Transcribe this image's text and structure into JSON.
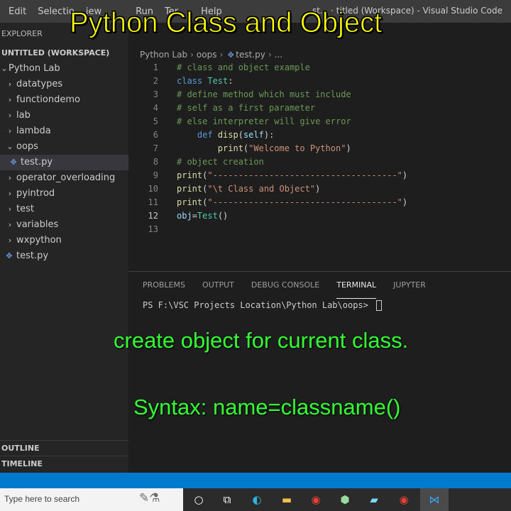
{
  "window": {
    "menus": [
      "Edit",
      "Selectio",
      "iew",
      "Run",
      "Ter",
      "Help"
    ],
    "title": "st... · titled (Workspace) - Visual Studio Code"
  },
  "overlays": {
    "title": "Python Class and Object",
    "line1": "create object for current class.",
    "line2": "Syntax: name=classname()"
  },
  "sidebar": {
    "explorer_label": "EXPLORER",
    "workspace_label": "UNTITLED (WORKSPACE)",
    "root_folder": "Python Lab",
    "items": [
      {
        "label": "datatypes",
        "type": "folder"
      },
      {
        "label": "functiondemo",
        "type": "folder"
      },
      {
        "label": "lab",
        "type": "folder"
      },
      {
        "label": "lambda",
        "type": "folder"
      },
      {
        "label": "oops",
        "type": "folder-open"
      },
      {
        "label": "test.py",
        "type": "file-child"
      },
      {
        "label": "operator_overloading",
        "type": "folder"
      },
      {
        "label": "pyintrod",
        "type": "folder"
      },
      {
        "label": "test",
        "type": "folder"
      },
      {
        "label": "variables",
        "type": "folder"
      },
      {
        "label": "wxpython",
        "type": "folder"
      },
      {
        "label": "test.py",
        "type": "file"
      }
    ],
    "outline_label": "OUTLINE",
    "timeline_label": "TIMELINE"
  },
  "breadcrumb": {
    "root": "Python Lab",
    "folder": "oops",
    "file": "test.py",
    "tail": "..."
  },
  "code_lines": [
    [
      {
        "t": "# class and object example",
        "c": "comment"
      }
    ],
    [
      {
        "t": "class ",
        "c": "kw"
      },
      {
        "t": "Test",
        "c": "cls"
      },
      {
        "t": ":",
        "c": "plain"
      }
    ],
    [
      {
        "t": "# define method which must include",
        "c": "comment"
      }
    ],
    [
      {
        "t": "# self as a first parameter",
        "c": "comment"
      }
    ],
    [
      {
        "t": "# else interpreter will give error",
        "c": "comment"
      }
    ],
    [
      {
        "t": "    ",
        "c": "plain"
      },
      {
        "t": "def ",
        "c": "kw"
      },
      {
        "t": "disp",
        "c": "fn"
      },
      {
        "t": "(",
        "c": "plain"
      },
      {
        "t": "self",
        "c": "var"
      },
      {
        "t": "):",
        "c": "plain"
      }
    ],
    [
      {
        "t": "        ",
        "c": "plain"
      },
      {
        "t": "print",
        "c": "fn"
      },
      {
        "t": "(",
        "c": "plain"
      },
      {
        "t": "\"Welcome to Python\"",
        "c": "str"
      },
      {
        "t": ")",
        "c": "plain"
      }
    ],
    [
      {
        "t": "# object creation",
        "c": "comment"
      }
    ],
    [
      {
        "t": "print",
        "c": "fn"
      },
      {
        "t": "(",
        "c": "plain"
      },
      {
        "t": "\"------------------------------------\"",
        "c": "str"
      },
      {
        "t": ")",
        "c": "plain"
      }
    ],
    [
      {
        "t": "print",
        "c": "fn"
      },
      {
        "t": "(",
        "c": "plain"
      },
      {
        "t": "\"\\t Class and Object\"",
        "c": "str"
      },
      {
        "t": ")",
        "c": "plain"
      }
    ],
    [
      {
        "t": "print",
        "c": "fn"
      },
      {
        "t": "(",
        "c": "plain"
      },
      {
        "t": "\"------------------------------------\"",
        "c": "str"
      },
      {
        "t": ")",
        "c": "plain"
      }
    ],
    [
      {
        "t": "obj",
        "c": "var"
      },
      {
        "t": "=",
        "c": "plain"
      },
      {
        "t": "Test",
        "c": "cls"
      },
      {
        "t": "()",
        "c": "plain"
      }
    ],
    []
  ],
  "active_line": 12,
  "panel": {
    "tabs": [
      "PROBLEMS",
      "OUTPUT",
      "DEBUG CONSOLE",
      "TERMINAL",
      "JUPYTER"
    ],
    "active_tab": "TERMINAL",
    "terminal_prompt": "PS F:\\VSC Projects Location\\Python Lab\\oops> "
  },
  "taskbar": {
    "search_placeholder": "Type here to search",
    "icons": [
      "cortana-circle-icon",
      "task-view-icon",
      "edge-browser-icon",
      "file-explorer-icon",
      "chrome-icon",
      "app-cube-icon",
      "terminal-app-icon",
      "chrome-alt-icon",
      "vscode-icon"
    ]
  },
  "colors": {
    "status_bar": "#007acc",
    "overlay_title": "#ffff00",
    "overlay_caption": "#33ff33"
  }
}
